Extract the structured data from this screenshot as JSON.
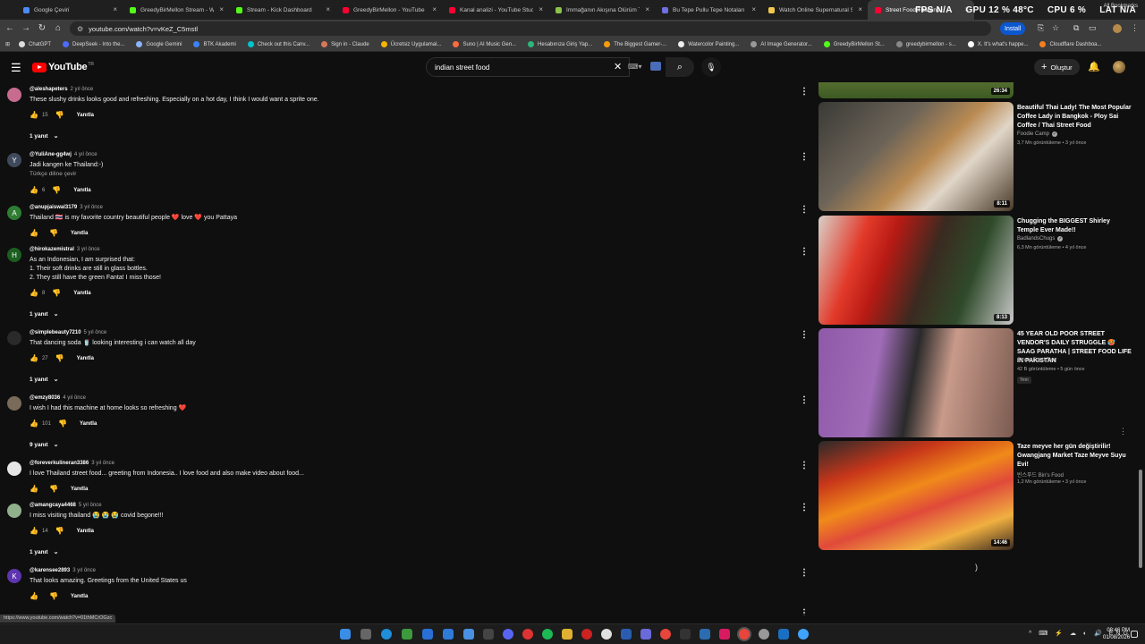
{
  "browser": {
    "tabs": [
      {
        "title": "Google Çeviri",
        "color": "#4c8bf5"
      },
      {
        "title": "GreedyBirMellon Stream - Wat",
        "color": "#53fc18"
      },
      {
        "title": "Stream - Kick Dashboard",
        "color": "#53fc18"
      },
      {
        "title": "GreedyBirMellon - YouTube",
        "color": "#ff0033"
      },
      {
        "title": "Kanal analizi - YouTube Studio",
        "color": "#ff0033"
      },
      {
        "title": "İmmağanın Akışına Ölürüm Türk",
        "color": "#8bc34a"
      },
      {
        "title": "Bu Tepe Pullu Tepe Notaları | N",
        "color": "#6f6fe0"
      },
      {
        "title": "Watch Online Supernatural Sea",
        "color": "#f2c94c"
      },
      {
        "title": "Street Food Thailand",
        "color": "#ff0033"
      }
    ],
    "hud": {
      "fps": "FPS N/A",
      "gpu": "GPU 12 % 48°C",
      "cpu": "CPU 6 %",
      "lat": "LAT N/A"
    },
    "url": "youtube.com/watch?v=vKeZ_C5mstl",
    "install_label": "Install",
    "bookmarks": [
      {
        "label": "ChatGPT",
        "color": "#ddd"
      },
      {
        "label": "DeepSeek - Into the...",
        "color": "#4d6bfe"
      },
      {
        "label": "Google Gemini",
        "color": "#8ab4f8"
      },
      {
        "label": "BTK Akademi",
        "color": "#3b82f6"
      },
      {
        "label": "Check out this Canv...",
        "color": "#00c4cc"
      },
      {
        "label": "Sign in - Claude",
        "color": "#d97757"
      },
      {
        "label": "Ücretsiz Uygulamal...",
        "color": "#f4b400"
      },
      {
        "label": "Suno | AI Music Gen...",
        "color": "#ff6b3d"
      },
      {
        "label": "Hesabınıza Giriş Yap...",
        "color": "#2db67c"
      },
      {
        "label": "The Biggest Gamer-...",
        "color": "#f59e0b"
      },
      {
        "label": "Watercolor Painting...",
        "color": "#eee"
      },
      {
        "label": "AI Image Generator...",
        "color": "#999"
      },
      {
        "label": "GreedyBirMellon St...",
        "color": "#53fc18"
      },
      {
        "label": "greedybirmellon - s...",
        "color": "#888"
      },
      {
        "label": "X. It's what's happe...",
        "color": "#fff"
      },
      {
        "label": "Cloudflare Dashboa...",
        "color": "#f38020"
      }
    ],
    "all_bookmarks": "All Bookmarks",
    "status_url": "https://www.youtube.com/watch?v=01thMCrOGzc"
  },
  "youtube": {
    "logo_text": "YouTube",
    "country": "TR",
    "search_value": "indian street food",
    "create_label": "Oluştur"
  },
  "labels": {
    "reply": "Yanıtla",
    "translate": "Türkçe diline çevir"
  },
  "comments": [
    {
      "handle": "@aleshapeters",
      "ago": "2 yıl önce",
      "text": [
        "These slushy drinks looks good and refreshing. Especially on a hot day, I think I would want a sprite one."
      ],
      "likes": "15",
      "replies": "1 yanıt",
      "avatar_letter": "",
      "avatar_color": "#c76b8f"
    },
    {
      "handle": "@YuliAne-gg4wj",
      "ago": "4 yıl önce",
      "text": [
        "Jadi kangen ke Thailand:-)"
      ],
      "translate": true,
      "likes": "6",
      "replies": "",
      "avatar_letter": "Y",
      "avatar_color": "#3e4a5c"
    },
    {
      "handle": "@anupjaiswal3179",
      "ago": "3 yıl önce",
      "text": [
        "Thailand 🇹🇭 is my favorite country beautiful people ❤️ love ❤️ you Pattaya"
      ],
      "likes": "",
      "replies": "",
      "avatar_letter": "A",
      "avatar_color": "#2e7d32"
    },
    {
      "handle": "@hirokazemistral",
      "ago": "3 yıl önce",
      "text": [
        "As an Indonesian, I am surprised that:",
        "1. Their soft drinks are still in glass bottles.",
        "2. They still have the green Fanta! I miss those!"
      ],
      "likes": "8",
      "replies": "1 yanıt",
      "avatar_letter": "H",
      "avatar_color": "#1b5e20"
    },
    {
      "handle": "@simplebeauty7210",
      "ago": "5 yıl önce",
      "text": [
        "That dancing soda 🥤 looking interesting i can watch all day"
      ],
      "likes": "27",
      "replies": "1 yanıt",
      "avatar_letter": "",
      "avatar_color": "#2a2a2a"
    },
    {
      "handle": "@emzy8036",
      "ago": "4 yıl önce",
      "text": [
        "I wish I had this machine at home looks so refreshing ❤️"
      ],
      "likes": "101",
      "replies": "9 yanıt",
      "avatar_letter": "",
      "avatar_color": "#7a6a5a"
    },
    {
      "handle": "@foreverkulineran3386",
      "ago": "3 yıl önce",
      "text": [
        "I love Thailand street food... greeting from Indonesia..  I love food and also make video about food..."
      ],
      "likes": "",
      "replies": "",
      "avatar_letter": "",
      "avatar_color": "#e6e6e6"
    },
    {
      "handle": "@amangcaya4468",
      "ago": "5 yıl önce",
      "text": [
        "I miss visiting thailand 😭 😭 😭 covid begone!!!"
      ],
      "likes": "14",
      "replies": "1 yanıt",
      "avatar_letter": "",
      "avatar_color": "#8fb08a"
    },
    {
      "handle": "@karensee2893",
      "ago": "3 yıl önce",
      "text": [
        "That looks amazing. Greetings from the United States us"
      ],
      "likes": "",
      "replies": "",
      "avatar_letter": "K",
      "avatar_color": "#5e35b1"
    }
  ],
  "recommendations": [
    {
      "title": "",
      "channel": "",
      "meta": "",
      "duration": "26:34",
      "thumb": "linear-gradient(180deg,#6a7a40 0%,#98a84c 40%,#3d5a24 100%)"
    },
    {
      "title": "Beautiful Thai Lady! The Most Popular Coffee Lady in  Bangkok - Ploy Sai Coffee / Thai Street Food",
      "channel": "Foodie Camp",
      "verified": true,
      "meta": "3,7 Mn görüntüleme • 3 yıl önce",
      "duration": "8:11",
      "thumb": "linear-gradient(135deg,#3a3a36 0%,#6d6458 35%,#b98a52 55%,#e0d6c8 70%,#4a3a2a 100%)"
    },
    {
      "title": "Chugging the BIGGEST Shirley Temple Ever Made!!",
      "channel": "BadlandsChugs",
      "verified": true,
      "meta": "6,3 Mn görüntüleme • 4 yıl önce",
      "duration": "8:13",
      "thumb": "linear-gradient(110deg,#d8d0c8 0%,#e23a2a 22%,#b81a14 35%,#3a2a20 55%,#2f4a2a 75%,#c8c8c8 100%)"
    },
    {
      "title": "45 YEAR OLD POOR STREET VENDOR'S DAILY STRUGGLE 🥵 SAAG PARATHA | STREET FOOD LIFE IN PAKISTAN",
      "channel": "Street Food Tour",
      "verified": false,
      "meta": "42 B görüntüleme • 5 gün önce",
      "badge": "Yeni",
      "duration": "",
      "thumb": "linear-gradient(100deg,#8e5aa8 0%,#a06cb8 30%,#2a2a2a 48%,#c89a8a 65%,#7a5a50 100%)"
    },
    {
      "title": "Taze meyve her gün değiştirilir! Gwangjang Market Taze Meyve Suyu Evi!",
      "channel": "빈스푸드 Bin's Food",
      "verified": false,
      "meta": "1,2 Mn görüntüleme • 3 yıl önce",
      "duration": "14:46",
      "thumb": "linear-gradient(160deg,#2a2a2a 0%,#c8361a 25%,#f08a1a 45%,#e04a3a 60%,#f0b040 80%,#3a2a20 100%)"
    }
  ],
  "taskbar": {
    "time": "08:46 PM",
    "date": "01/08/2026",
    "tray": "^ ⌨ ⚡ ☁ ◐ 🔊 ENG"
  }
}
